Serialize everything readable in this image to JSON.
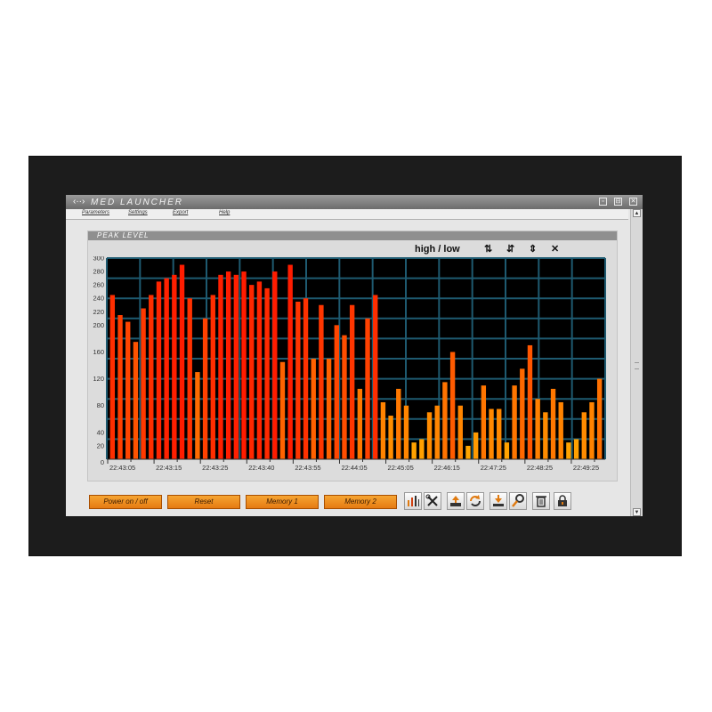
{
  "window": {
    "title": "MED LAUNCHER",
    "app_icon": "‹··›"
  },
  "menu": [
    "Parameters",
    "Settings",
    "Export",
    "Help"
  ],
  "panel": {
    "title": "PEAK LEVEL",
    "mode_label": "high / low"
  },
  "chart_data": {
    "type": "bar",
    "ylim": [
      0,
      300
    ],
    "y_ticks": [
      0,
      20,
      40,
      80,
      120,
      160,
      200,
      220,
      240,
      260,
      280,
      300
    ],
    "x_tick_labels": [
      "22:43:05",
      "22:43:15",
      "22:43:25",
      "22:43:40",
      "22:43:55",
      "22:44:05",
      "22:45:05",
      "22:46:15",
      "22:47:25",
      "22:48:25",
      "22:49:25"
    ],
    "grid": true,
    "values": [
      245,
      215,
      205,
      175,
      225,
      245,
      265,
      270,
      275,
      290,
      240,
      130,
      210,
      245,
      275,
      280,
      275,
      280,
      260,
      265,
      255,
      280,
      145,
      290,
      235,
      240,
      150,
      230,
      150,
      200,
      185,
      230,
      105,
      210,
      245,
      85,
      65,
      105,
      80,
      25,
      30,
      70,
      80,
      115,
      160,
      80,
      20,
      40,
      110,
      75,
      75,
      25,
      110,
      135,
      170,
      90,
      70,
      105,
      85,
      25,
      30,
      70,
      85,
      120
    ],
    "colors": {
      "low": "#ffa500",
      "high": "#ff1c00"
    }
  },
  "buttons": [
    "Power on / off",
    "Reset",
    "Memory 1",
    "Memory 2"
  ],
  "icon_buttons": [
    "equalizer-icon",
    "tools-icon",
    "upload-icon",
    "refresh-icon",
    "download-icon",
    "search-icon",
    "trash-icon",
    "lock-icon"
  ]
}
